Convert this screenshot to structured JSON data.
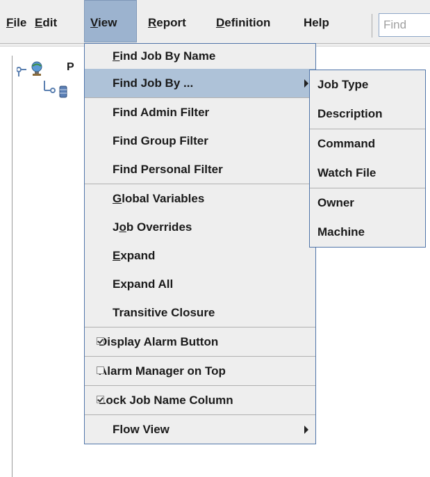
{
  "menubar": {
    "items": [
      {
        "label": "File",
        "mnemonic": "F",
        "rest": "ile"
      },
      {
        "label": "Edit",
        "mnemonic": "E",
        "rest": "dit"
      },
      {
        "label": "View",
        "mnemonic": "V",
        "rest": "iew"
      },
      {
        "label": "Report",
        "mnemonic": "R",
        "rest": "eport"
      },
      {
        "label": "Definition",
        "mnemonic": "D",
        "rest": "efinition"
      },
      {
        "label": "Help",
        "mnemonic": "",
        "rest": "Help"
      }
    ],
    "find_placeholder": "Find"
  },
  "tree": {
    "root_label_partial": "P",
    "icons": [
      "globe-icon",
      "database-icon"
    ]
  },
  "view_menu": {
    "items": [
      {
        "label": "Find Job By Name",
        "mnemonic": "F",
        "rest": "ind Job By Name"
      },
      {
        "label": "Find Job By ...",
        "submenu": true
      },
      {
        "label": "Find Admin Filter"
      },
      {
        "label": "Find Group Filter"
      },
      {
        "label": "Find Personal Filter"
      },
      {
        "label": "Global Variables",
        "mnemonic": "G",
        "rest": "lobal Variables"
      },
      {
        "label": "Job Overrides",
        "pre": "J",
        "mnemonic": "o",
        "rest": "b Overrides"
      },
      {
        "label": "Expand",
        "mnemonic": "E",
        "rest": "xpand"
      },
      {
        "label": "Expand All"
      },
      {
        "label": "Transitive Closure"
      },
      {
        "label": "Display Alarm Button",
        "checked": true
      },
      {
        "label": "Alarm Manager on Top",
        "checked": false
      },
      {
        "label": "Lock Job Name Column",
        "checked": true
      },
      {
        "label": "Flow View",
        "submenu": true
      }
    ]
  },
  "find_job_by_submenu": {
    "items": [
      "Job Type",
      "Description",
      "Command",
      "Watch File",
      "Owner",
      "Machine"
    ]
  },
  "colors": {
    "accent": "#9cb3cf",
    "menu_border": "#4f74a8",
    "menu_bg": "#eeeeee"
  }
}
